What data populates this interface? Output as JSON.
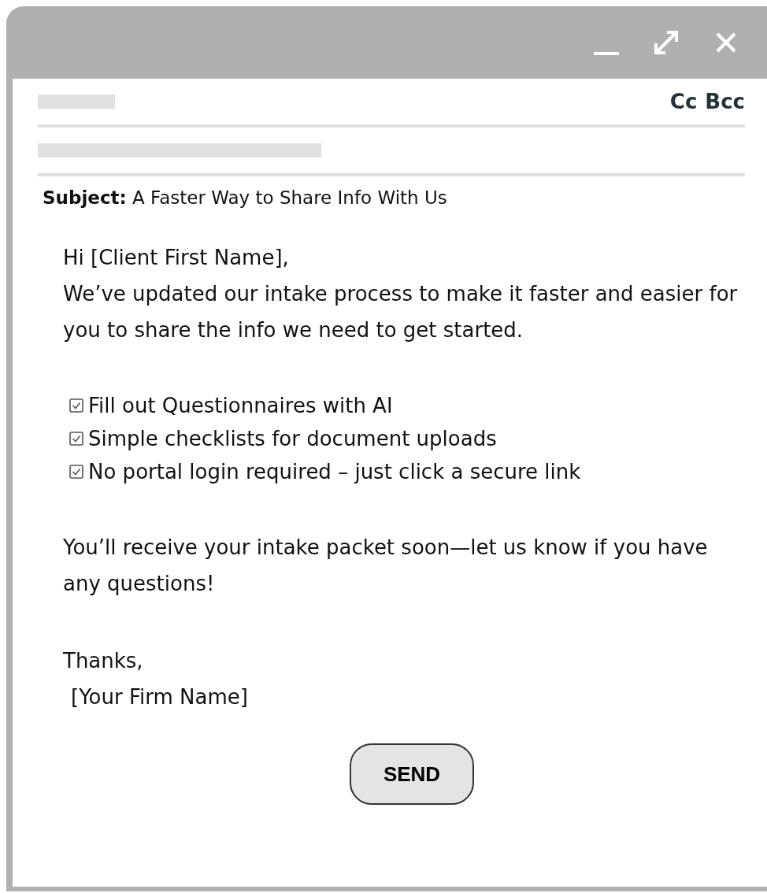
{
  "window_controls": [
    {
      "kind": "minimize"
    },
    {
      "kind": "maximize"
    },
    {
      "kind": "close"
    }
  ],
  "header": {
    "cc": "Cc",
    "bcc": "Bcc"
  },
  "subject": {
    "label": "Subject:",
    "value": "A Faster Way to Share Info With Us"
  },
  "body": {
    "greeting": "Hi [Client First Name],",
    "intro": "We’ve updated our intake process to make it faster and easier for you to share the info we need to get started.",
    "checklist": [
      {
        "text": "Fill out Questionnaires with AI",
        "checked": true
      },
      {
        "text": "Simple checklists for document uploads",
        "checked": true
      },
      {
        "text": "No portal login required – just click a secure link",
        "checked": true
      }
    ],
    "closing": "You’ll receive your intake packet soon—let us know if you have any questions!",
    "signoff": "Thanks,",
    "signature": "[Your Firm Name]"
  },
  "send_button": "SEND"
}
